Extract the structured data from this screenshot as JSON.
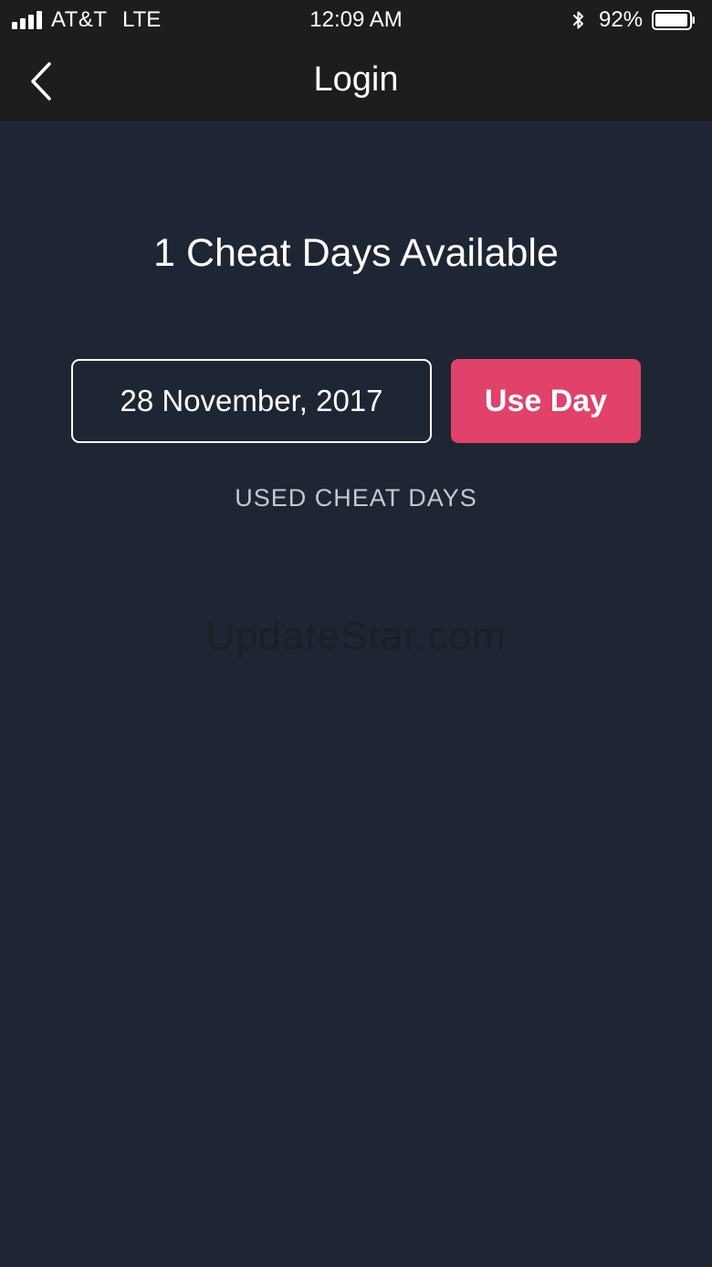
{
  "status_bar": {
    "carrier": "AT&T",
    "network": "LTE",
    "time": "12:09 AM",
    "battery_percent": "92%",
    "signal_icon": "cellular-signal-icon",
    "bluetooth_icon": "bluetooth-icon",
    "battery_icon": "battery-icon"
  },
  "nav": {
    "title": "Login",
    "back_icon": "chevron-left-icon"
  },
  "main": {
    "available_text": "1 Cheat Days Available",
    "date_value": "28 November, 2017",
    "use_day_label": "Use Day",
    "used_section_label": "USED CHEAT DAYS"
  },
  "watermark": {
    "text": "UpdateStar.com"
  },
  "colors": {
    "background": "#1f2633",
    "topbar": "#1d1d1f",
    "accent": "#e0426a",
    "text": "#ffffff",
    "muted_text": "#c4c8cf"
  }
}
